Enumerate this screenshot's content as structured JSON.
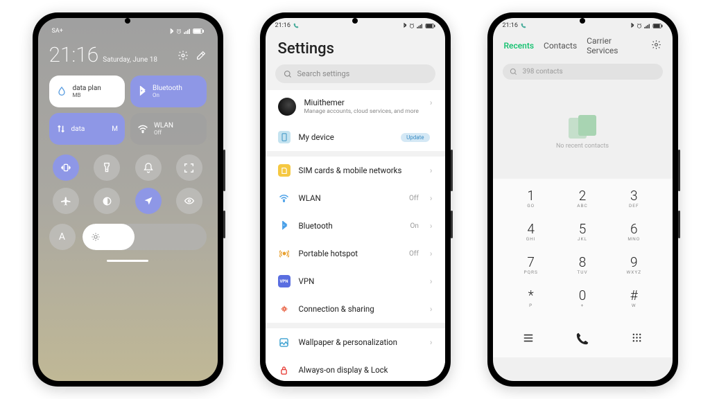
{
  "phone1": {
    "status": {
      "carrier": "SA+",
      "time": ""
    },
    "clock": {
      "time": "21:16",
      "date": "Saturday, June 18"
    },
    "tiles": {
      "data_plan": {
        "label": "data plan",
        "sub": "MB"
      },
      "bluetooth": {
        "label": "Bluetooth",
        "sub": "On"
      },
      "mobile_data": {
        "label": "data",
        "carrier": "M"
      },
      "wlan": {
        "label": "WLAN",
        "sub": "Off"
      }
    },
    "auto_brightness_label": "A"
  },
  "phone2": {
    "status": {
      "time": "21:16"
    },
    "title": "Settings",
    "search_placeholder": "Search settings",
    "account": {
      "name": "Miuithemer",
      "desc": "Manage accounts, cloud services, and more"
    },
    "items": {
      "my_device": {
        "label": "My device",
        "badge": "Update"
      },
      "sim": {
        "label": "SIM cards & mobile networks"
      },
      "wlan": {
        "label": "WLAN",
        "status": "Off"
      },
      "bluetooth": {
        "label": "Bluetooth",
        "status": "On"
      },
      "hotspot": {
        "label": "Portable hotspot",
        "status": "Off"
      },
      "vpn": {
        "label": "VPN"
      },
      "connection": {
        "label": "Connection & sharing"
      },
      "wallpaper": {
        "label": "Wallpaper & personalization"
      },
      "aod": {
        "label": "Always-on display & Lock"
      }
    }
  },
  "phone3": {
    "status": {
      "time": "21:16"
    },
    "tabs": {
      "recents": "Recents",
      "contacts": "Contacts",
      "carrier": "Carrier Services"
    },
    "search_placeholder": "398 contacts",
    "empty_text": "No recent contacts",
    "keys": [
      {
        "d": "1",
        "l": "GO"
      },
      {
        "d": "2",
        "l": "ABC"
      },
      {
        "d": "3",
        "l": "DEF"
      },
      {
        "d": "4",
        "l": "GHI"
      },
      {
        "d": "5",
        "l": "JKL"
      },
      {
        "d": "6",
        "l": "MNO"
      },
      {
        "d": "7",
        "l": "PQRS"
      },
      {
        "d": "8",
        "l": "TUV"
      },
      {
        "d": "9",
        "l": "WXYZ"
      },
      {
        "d": "*",
        "l": "P"
      },
      {
        "d": "0",
        "l": "+"
      },
      {
        "d": "#",
        "l": "W"
      }
    ]
  }
}
